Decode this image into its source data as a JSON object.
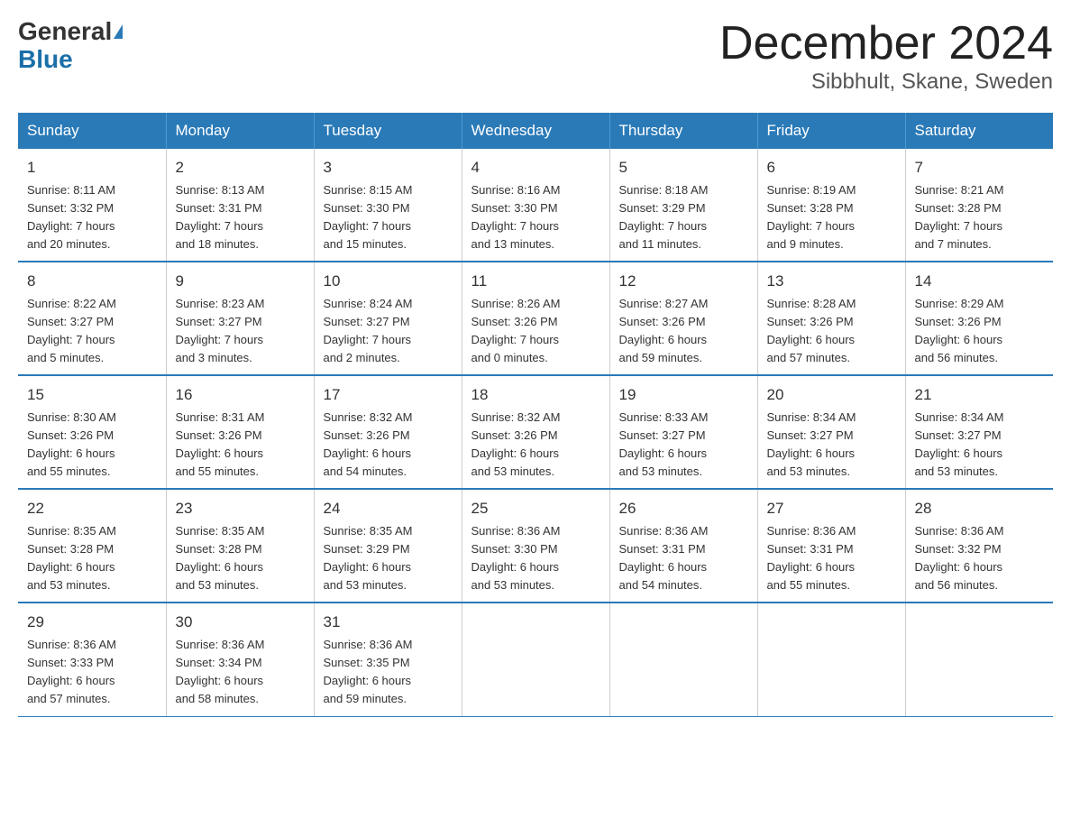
{
  "logo": {
    "general": "General",
    "blue": "Blue"
  },
  "title": {
    "month": "December 2024",
    "location": "Sibbhult, Skane, Sweden"
  },
  "weekdays": [
    "Sunday",
    "Monday",
    "Tuesday",
    "Wednesday",
    "Thursday",
    "Friday",
    "Saturday"
  ],
  "weeks": [
    [
      {
        "day": "1",
        "sunrise": "8:11 AM",
        "sunset": "3:32 PM",
        "daylight": "7 hours and 20 minutes."
      },
      {
        "day": "2",
        "sunrise": "8:13 AM",
        "sunset": "3:31 PM",
        "daylight": "7 hours and 18 minutes."
      },
      {
        "day": "3",
        "sunrise": "8:15 AM",
        "sunset": "3:30 PM",
        "daylight": "7 hours and 15 minutes."
      },
      {
        "day": "4",
        "sunrise": "8:16 AM",
        "sunset": "3:30 PM",
        "daylight": "7 hours and 13 minutes."
      },
      {
        "day": "5",
        "sunrise": "8:18 AM",
        "sunset": "3:29 PM",
        "daylight": "7 hours and 11 minutes."
      },
      {
        "day": "6",
        "sunrise": "8:19 AM",
        "sunset": "3:28 PM",
        "daylight": "7 hours and 9 minutes."
      },
      {
        "day": "7",
        "sunrise": "8:21 AM",
        "sunset": "3:28 PM",
        "daylight": "7 hours and 7 minutes."
      }
    ],
    [
      {
        "day": "8",
        "sunrise": "8:22 AM",
        "sunset": "3:27 PM",
        "daylight": "7 hours and 5 minutes."
      },
      {
        "day": "9",
        "sunrise": "8:23 AM",
        "sunset": "3:27 PM",
        "daylight": "7 hours and 3 minutes."
      },
      {
        "day": "10",
        "sunrise": "8:24 AM",
        "sunset": "3:27 PM",
        "daylight": "7 hours and 2 minutes."
      },
      {
        "day": "11",
        "sunrise": "8:26 AM",
        "sunset": "3:26 PM",
        "daylight": "7 hours and 0 minutes."
      },
      {
        "day": "12",
        "sunrise": "8:27 AM",
        "sunset": "3:26 PM",
        "daylight": "6 hours and 59 minutes."
      },
      {
        "day": "13",
        "sunrise": "8:28 AM",
        "sunset": "3:26 PM",
        "daylight": "6 hours and 57 minutes."
      },
      {
        "day": "14",
        "sunrise": "8:29 AM",
        "sunset": "3:26 PM",
        "daylight": "6 hours and 56 minutes."
      }
    ],
    [
      {
        "day": "15",
        "sunrise": "8:30 AM",
        "sunset": "3:26 PM",
        "daylight": "6 hours and 55 minutes."
      },
      {
        "day": "16",
        "sunrise": "8:31 AM",
        "sunset": "3:26 PM",
        "daylight": "6 hours and 55 minutes."
      },
      {
        "day": "17",
        "sunrise": "8:32 AM",
        "sunset": "3:26 PM",
        "daylight": "6 hours and 54 minutes."
      },
      {
        "day": "18",
        "sunrise": "8:32 AM",
        "sunset": "3:26 PM",
        "daylight": "6 hours and 53 minutes."
      },
      {
        "day": "19",
        "sunrise": "8:33 AM",
        "sunset": "3:27 PM",
        "daylight": "6 hours and 53 minutes."
      },
      {
        "day": "20",
        "sunrise": "8:34 AM",
        "sunset": "3:27 PM",
        "daylight": "6 hours and 53 minutes."
      },
      {
        "day": "21",
        "sunrise": "8:34 AM",
        "sunset": "3:27 PM",
        "daylight": "6 hours and 53 minutes."
      }
    ],
    [
      {
        "day": "22",
        "sunrise": "8:35 AM",
        "sunset": "3:28 PM",
        "daylight": "6 hours and 53 minutes."
      },
      {
        "day": "23",
        "sunrise": "8:35 AM",
        "sunset": "3:28 PM",
        "daylight": "6 hours and 53 minutes."
      },
      {
        "day": "24",
        "sunrise": "8:35 AM",
        "sunset": "3:29 PM",
        "daylight": "6 hours and 53 minutes."
      },
      {
        "day": "25",
        "sunrise": "8:36 AM",
        "sunset": "3:30 PM",
        "daylight": "6 hours and 53 minutes."
      },
      {
        "day": "26",
        "sunrise": "8:36 AM",
        "sunset": "3:31 PM",
        "daylight": "6 hours and 54 minutes."
      },
      {
        "day": "27",
        "sunrise": "8:36 AM",
        "sunset": "3:31 PM",
        "daylight": "6 hours and 55 minutes."
      },
      {
        "day": "28",
        "sunrise": "8:36 AM",
        "sunset": "3:32 PM",
        "daylight": "6 hours and 56 minutes."
      }
    ],
    [
      {
        "day": "29",
        "sunrise": "8:36 AM",
        "sunset": "3:33 PM",
        "daylight": "6 hours and 57 minutes."
      },
      {
        "day": "30",
        "sunrise": "8:36 AM",
        "sunset": "3:34 PM",
        "daylight": "6 hours and 58 minutes."
      },
      {
        "day": "31",
        "sunrise": "8:36 AM",
        "sunset": "3:35 PM",
        "daylight": "6 hours and 59 minutes."
      },
      null,
      null,
      null,
      null
    ]
  ],
  "labels": {
    "sunrise": "Sunrise:",
    "sunset": "Sunset:",
    "daylight": "Daylight:"
  }
}
